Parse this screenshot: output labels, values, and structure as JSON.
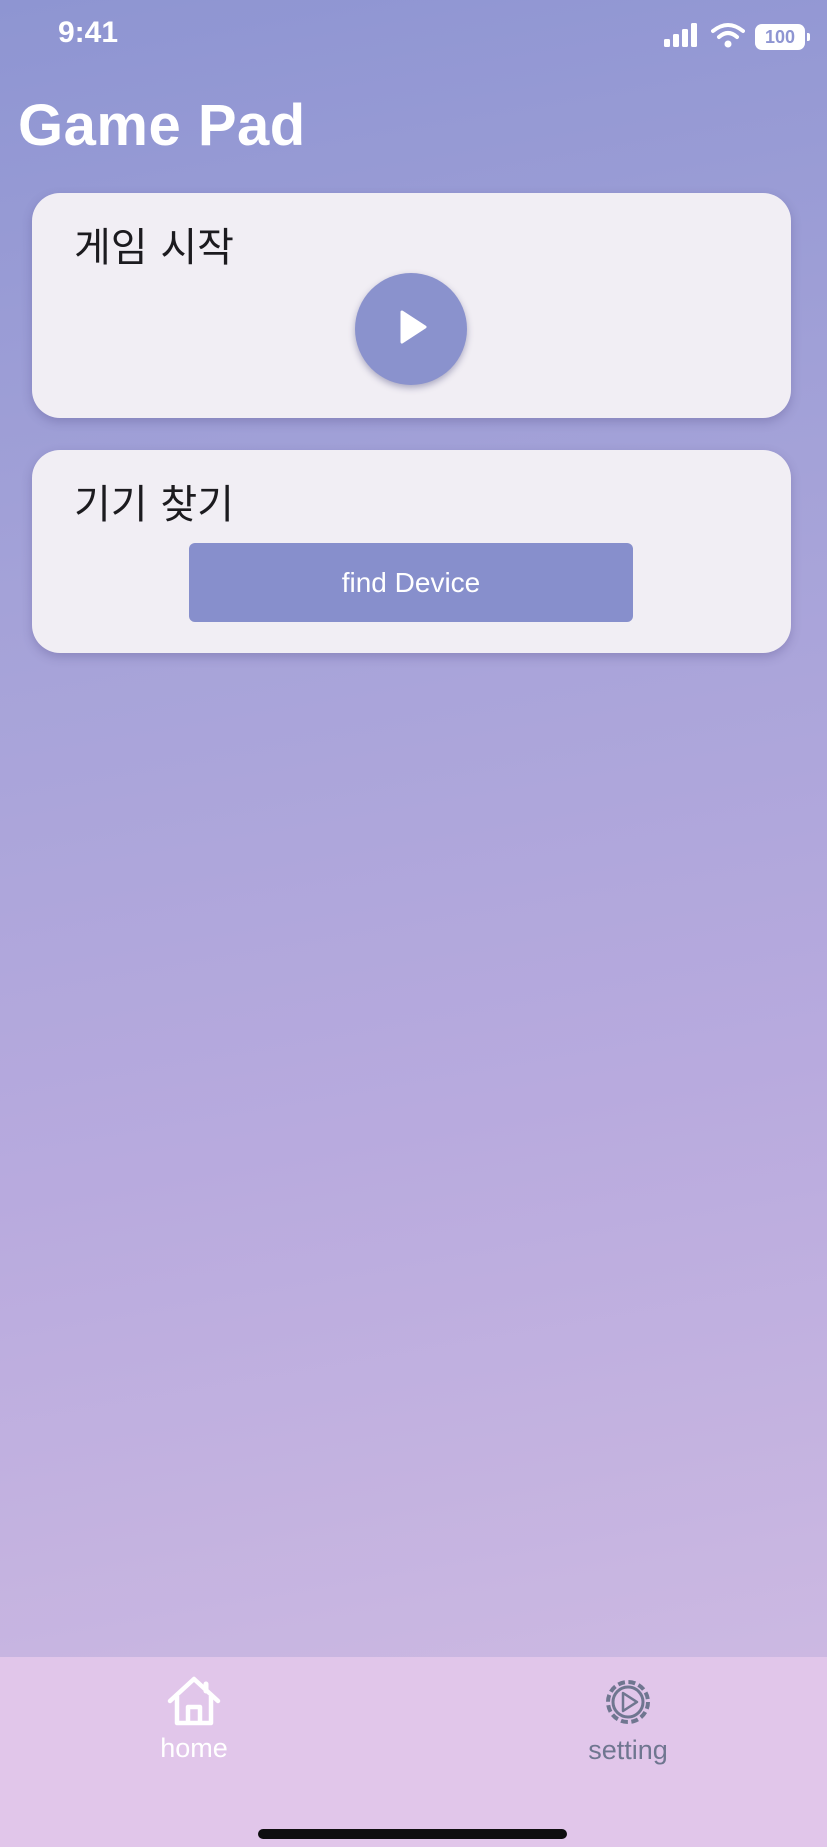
{
  "status_bar": {
    "time": "9:41",
    "battery": "100",
    "icons": [
      "signal-icon",
      "wifi-icon",
      "battery-icon"
    ]
  },
  "header": {
    "title": "Game Pad"
  },
  "cards": {
    "start_game": {
      "title": "게임 시작",
      "button_icon": "play-icon"
    },
    "find_device": {
      "title": "기기 찾기",
      "button_label": "find Device"
    }
  },
  "bottom_nav": {
    "items": [
      {
        "label": "home",
        "icon": "home-icon",
        "active": true
      },
      {
        "label": "setting",
        "icon": "gear-icon",
        "active": false
      }
    ]
  },
  "colors": {
    "accent": "#8a92cd",
    "card_background": "#f1eef4",
    "nav_background": "#e1c6ea",
    "active_nav": "#ffffff",
    "inactive_nav": "#6f7690"
  }
}
